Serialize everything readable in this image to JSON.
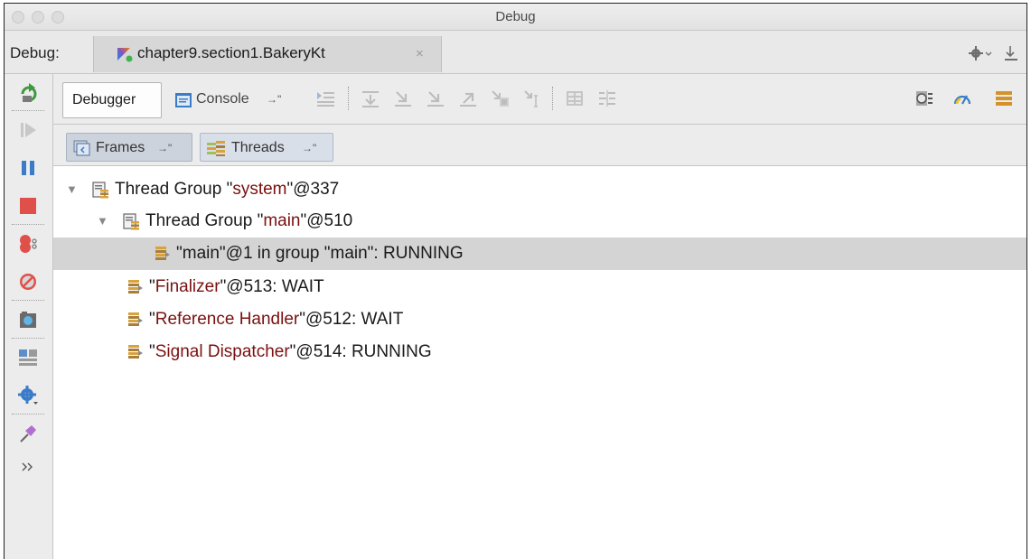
{
  "window": {
    "title": "Debug"
  },
  "tabbar": {
    "debug_label": "Debug:",
    "session_tab": "chapter9.section1.BakeryKt",
    "close_glyph": "×"
  },
  "toolbar": {
    "debugger_tab": "Debugger",
    "console_tab": "Console",
    "pin_glyph": "→\""
  },
  "subtabs": {
    "frames": "Frames",
    "threads": "Threads",
    "pin_glyph": "→\""
  },
  "tree": [
    {
      "pre": "Thread Group \"",
      "name": "system",
      "post": "\"@337",
      "icon": "thread-group-icon",
      "expanded": true
    },
    {
      "pre": "Thread Group \"",
      "name": "main",
      "post": "\"@510",
      "icon": "thread-group-icon",
      "expanded": true
    },
    {
      "pre": "\"main\"@1 in group \"main\": RUNNING",
      "name": "",
      "post": "",
      "icon": "thread-icon",
      "selected": true
    },
    {
      "pre": "\"",
      "name": "Finalizer",
      "post": "\"@513: WAIT",
      "icon": "thread-icon"
    },
    {
      "pre": "\"",
      "name": "Reference Handler",
      "post": "\"@512: WAIT",
      "icon": "thread-icon"
    },
    {
      "pre": "\"",
      "name": "Signal Dispatcher",
      "post": "\"@514: RUNNING",
      "icon": "thread-icon"
    }
  ],
  "colors": {
    "string_literal": "#7a1010",
    "selection": "#d4d4d4"
  }
}
